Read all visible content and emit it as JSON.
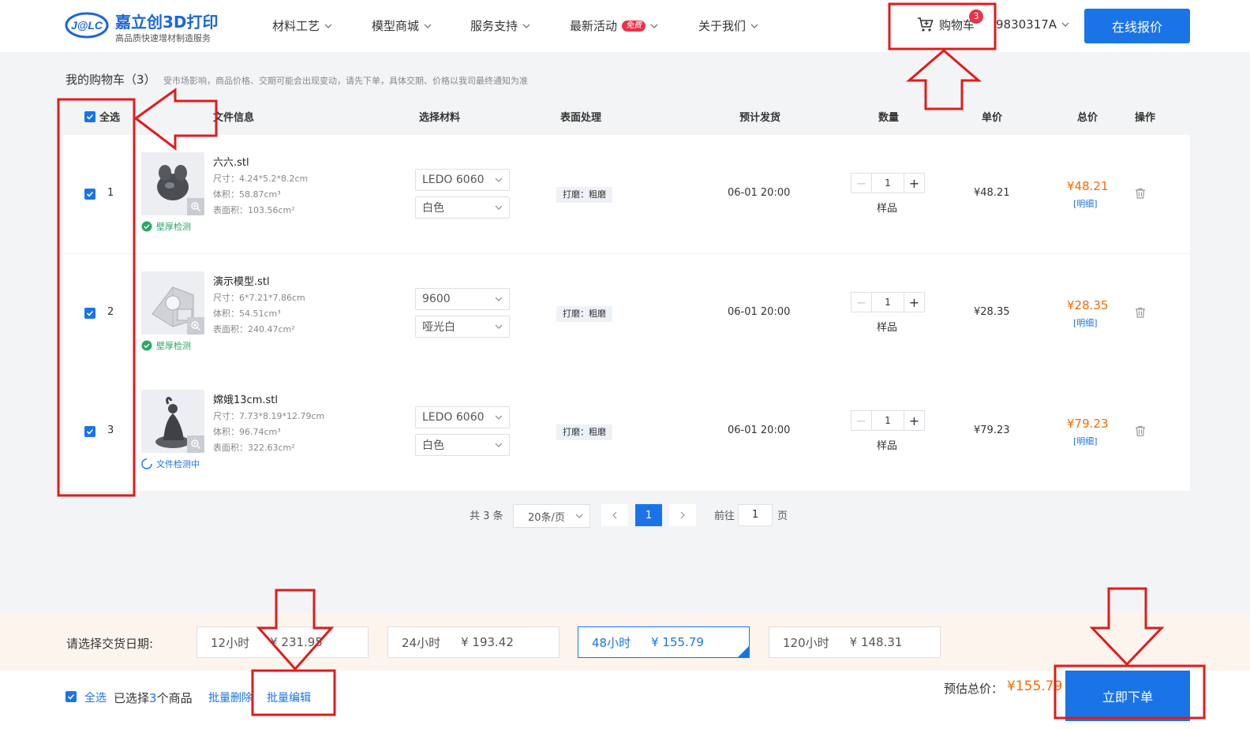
{
  "header": {
    "logo_mark": "J@LC",
    "logo_name": "嘉立创3D打印",
    "logo_sub": "高品质快速增材制造服务",
    "nav": [
      {
        "label": "材料工艺"
      },
      {
        "label": "模型商城"
      },
      {
        "label": "服务支持"
      },
      {
        "label": "最新活动",
        "badge": "免费"
      },
      {
        "label": "关于我们"
      }
    ],
    "cart_label": "购物车",
    "cart_count": "3",
    "user": "9830317A",
    "quote_button": "在线报价"
  },
  "cart": {
    "title": "我的购物车（3）",
    "note": "受市场影响，商品价格、交期可能会出现变动，请先下单，具体交期、价格以我司最终通知为准"
  },
  "table": {
    "headers": {
      "select_all": "全选",
      "file_info": "文件信息",
      "material": "选择材料",
      "surface": "表面处理",
      "ship": "预计发货",
      "qty": "数量",
      "unit_price": "单价",
      "total": "总价",
      "ops": "操作"
    },
    "rows": [
      {
        "index": "1",
        "file": "六六.stl",
        "size": "尺寸：4.24*5.2*8.2cm",
        "volume": "体积：58.87cm³",
        "area": "表面积：103.56cm²",
        "status": "壁厚检测",
        "material": "LEDO 6060",
        "color": "白色",
        "surface": "打磨：粗磨",
        "ship": "06-01 20:00",
        "qty": "1",
        "qty_type": "样品",
        "unit_price": "¥48.21",
        "total": "¥48.21",
        "detail": "[明细]"
      },
      {
        "index": "2",
        "file": "演示模型.stl",
        "size": "尺寸：6*7.21*7.86cm",
        "volume": "体积：54.51cm³",
        "area": "表面积：240.47cm²",
        "status": "壁厚检测",
        "material": "9600",
        "color": "哑光白",
        "surface": "打磨：粗磨",
        "ship": "06-01 20:00",
        "qty": "1",
        "qty_type": "样品",
        "unit_price": "¥28.35",
        "total": "¥28.35",
        "detail": "[明细]"
      },
      {
        "index": "3",
        "file": "嫦娥13cm.stl",
        "size": "尺寸：7.73*8.19*12.79cm",
        "volume": "体积：96.74cm³",
        "area": "表面积：322.63cm²",
        "status": "文件检测中",
        "material": "LEDO 6060",
        "color": "白色",
        "surface": "打磨：粗磨",
        "ship": "06-01 20:00",
        "qty": "1",
        "qty_type": "样品",
        "unit_price": "¥79.23",
        "total": "¥79.23",
        "detail": "[明细]"
      }
    ]
  },
  "pager": {
    "total": "共 3 条",
    "page_size": "20条/页",
    "current": "1",
    "goto_prefix": "前往",
    "goto_value": "1",
    "goto_suffix": "页"
  },
  "delivery": {
    "label": "请选择交货日期:",
    "options": [
      {
        "time": "12小时",
        "price": "¥ 231.95"
      },
      {
        "time": "24小时",
        "price": "¥ 193.42"
      },
      {
        "time": "48小时",
        "price": "¥ 155.79",
        "selected": true
      },
      {
        "time": "120小时",
        "price": "¥ 148.31"
      }
    ]
  },
  "footer": {
    "select_all": "全选",
    "selected_prefix": "已选择",
    "selected_count": "3",
    "selected_suffix": "个商品",
    "batch_delete": "批量删除",
    "batch_edit": "批量编辑",
    "estimate_label": "预估总价：",
    "estimate_value": "¥155.79",
    "order_button": "立即下单"
  },
  "colors": {
    "primary": "#1a74e8",
    "price": "#f56a00",
    "badge": "#e8334a",
    "annotation": "#e11b1b"
  }
}
